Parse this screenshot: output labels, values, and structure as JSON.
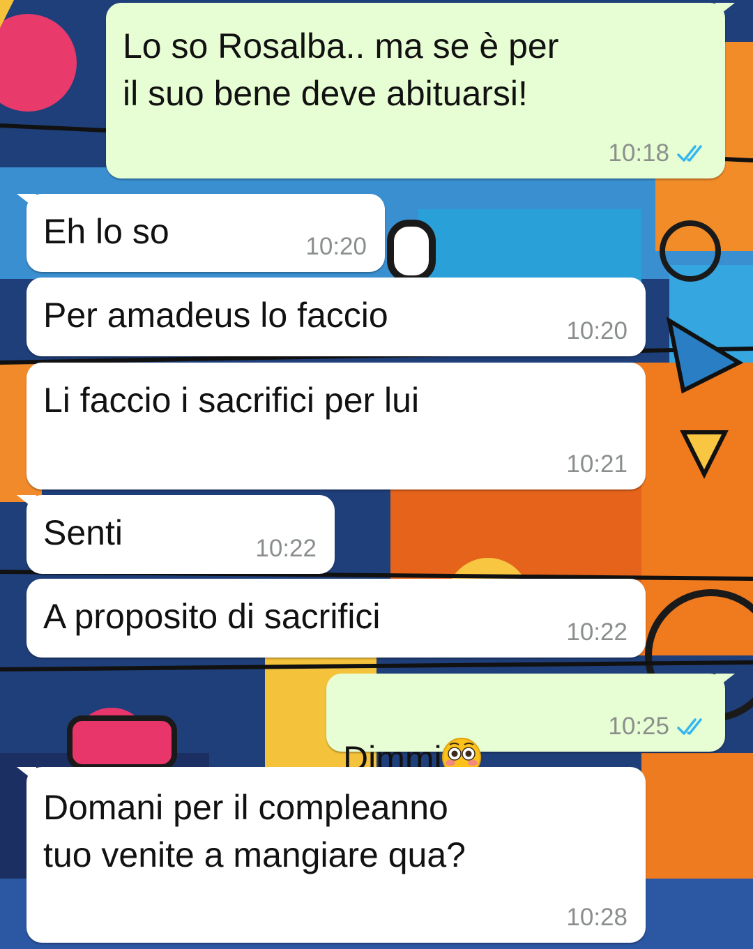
{
  "theme": {
    "incoming_bubble": "#ffffff",
    "outgoing_bubble": "#e7fdd3",
    "read_ticks": "#34b7f1"
  },
  "messages": [
    {
      "direction": "outgoing",
      "text": "Lo so Rosalba.. ma se è per\nil suo bene deve abituarsi!",
      "time": "10:18",
      "status": "read",
      "status_icon": "double-check-icon"
    },
    {
      "direction": "incoming",
      "text": "Eh lo so",
      "time": "10:20"
    },
    {
      "direction": "incoming",
      "text": "Per amadeus lo faccio",
      "time": "10:20"
    },
    {
      "direction": "incoming",
      "text": "Li faccio i sacrifici per lui",
      "time": "10:21"
    },
    {
      "direction": "incoming",
      "text": "Senti",
      "time": "10:22"
    },
    {
      "direction": "incoming",
      "text": "A proposito di sacrifici",
      "time": "10:22"
    },
    {
      "direction": "outgoing",
      "text": "Dimmi",
      "emoji": "flushed-face-emoji",
      "time": "10:25",
      "status": "read",
      "status_icon": "double-check-icon"
    },
    {
      "direction": "incoming",
      "text": "Domani per il compleanno\ntuo venite a mangiare qua?",
      "time": "10:28"
    }
  ]
}
